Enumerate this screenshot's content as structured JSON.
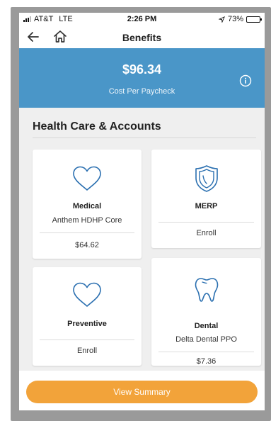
{
  "status_bar": {
    "carrier": "AT&T",
    "network": "LTE",
    "time": "2:26 PM",
    "battery": "73%",
    "battery_level": 0.73
  },
  "nav": {
    "title": "Benefits",
    "back_icon": "arrow-left-icon",
    "home_icon": "home-icon"
  },
  "banner": {
    "amount": "$96.34",
    "caption": "Cost Per Paycheck",
    "info_icon": "info-icon",
    "color": "#4a96c8"
  },
  "section": {
    "title": "Health Care & Accounts"
  },
  "cards": {
    "medical": {
      "icon": "heart-icon",
      "name": "Medical",
      "plan": "Anthem HDHP Core",
      "value": "$64.62"
    },
    "merp": {
      "icon": "shield-icon",
      "name": "MERP",
      "value": "Enroll"
    },
    "preventive": {
      "icon": "heart-icon",
      "name": "Preventive",
      "value": "Enroll"
    },
    "dental": {
      "icon": "tooth-icon",
      "name": "Dental",
      "plan": "Delta Dental PPO",
      "value": "$7.36"
    }
  },
  "footer": {
    "summary_label": "View Summary",
    "button_color": "#f2a33a"
  },
  "colors": {
    "accent_blue": "#2a6fb0",
    "banner_blue": "#4a96c8",
    "orange": "#f2a33a"
  }
}
